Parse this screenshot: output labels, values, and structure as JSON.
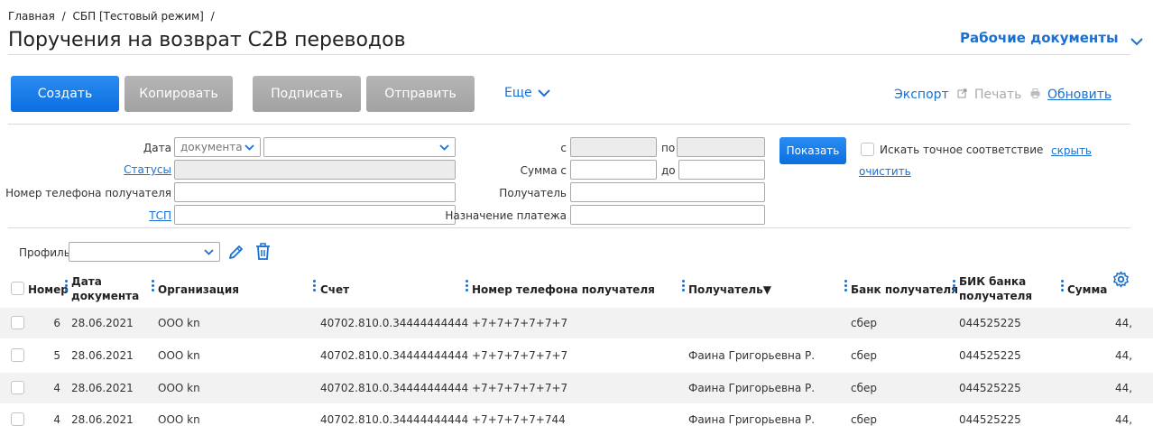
{
  "breadcrumb": {
    "home": "Главная",
    "sep1": "/",
    "section": "СБП [Тестовый режим]",
    "sep2": "/"
  },
  "page_title": "Поручения на возврат С2В переводов",
  "work_docs": "Рабочие документы",
  "toolbar": {
    "create": "Создать",
    "copy": "Копировать",
    "sign": "Подписать",
    "send": "Отправить",
    "more": "Еще",
    "export": "Экспорт",
    "print": "Печать",
    "refresh": "Обновить"
  },
  "filters": {
    "date_label": "Дата",
    "date_type": "документа",
    "date_period": "",
    "statuses": "Статусы",
    "phone": "Номер телефона получателя",
    "tsp": "ТСП",
    "from": "с",
    "to": "по",
    "sum_from": "Сумма с",
    "sum_to": "до",
    "recipient": "Получатель",
    "purpose": "Назначение платежа",
    "show": "Показать",
    "exact": "Искать точное соответствие",
    "hide": "скрыть",
    "clear": "очистить"
  },
  "profile": {
    "label": "Профиль",
    "value": ""
  },
  "table": {
    "headers": {
      "number": "Номер",
      "date": "Дата документа",
      "org": "Организация",
      "account": "Счет",
      "phone": "Номер телефона получателя",
      "recipient": "Получатель▼",
      "bank": "Банк получателя",
      "bik": "БИК банка получателя",
      "sum": "Сумма"
    },
    "rows": [
      {
        "number": "6",
        "date": "28.06.2021",
        "org": "ООО kn",
        "account": "40702.810.0.34444444444",
        "phone": "+7+7+7+7+7+7",
        "recipient": "",
        "bank": "сбер",
        "bik": "044525225",
        "sum": "44,"
      },
      {
        "number": "5",
        "date": "28.06.2021",
        "org": "ООО kn",
        "account": "40702.810.0.34444444444",
        "phone": "+7+7+7+7+7+7",
        "recipient": "Фаина Григорьевна Р.",
        "bank": "сбер",
        "bik": "044525225",
        "sum": "44,"
      },
      {
        "number": "4",
        "date": "28.06.2021",
        "org": "ООО kn",
        "account": "40702.810.0.34444444444",
        "phone": "+7+7+7+7+7+7",
        "recipient": "Фаина Григорьевна Р.",
        "bank": "сбер",
        "bik": "044525225",
        "sum": "44,"
      },
      {
        "number": "4",
        "date": "28.06.2021",
        "org": "ООО kn",
        "account": "40702.810.0.34444444444",
        "phone": "+7+7+7+7+744",
        "recipient": "Фаина Григорьевна Р.",
        "bank": "сбер",
        "bik": "044525225",
        "sum": "44,"
      }
    ]
  },
  "icons": {
    "chevron": "chevron-down-icon",
    "export": "external-link-icon",
    "print": "printer-icon",
    "edit": "pencil-icon",
    "delete": "trash-icon",
    "settings": "gear-icon"
  },
  "colors": {
    "accent": "#1a6fd0",
    "primary_button": "#0a6fe0",
    "disabled_button": "#a9a9a9"
  }
}
